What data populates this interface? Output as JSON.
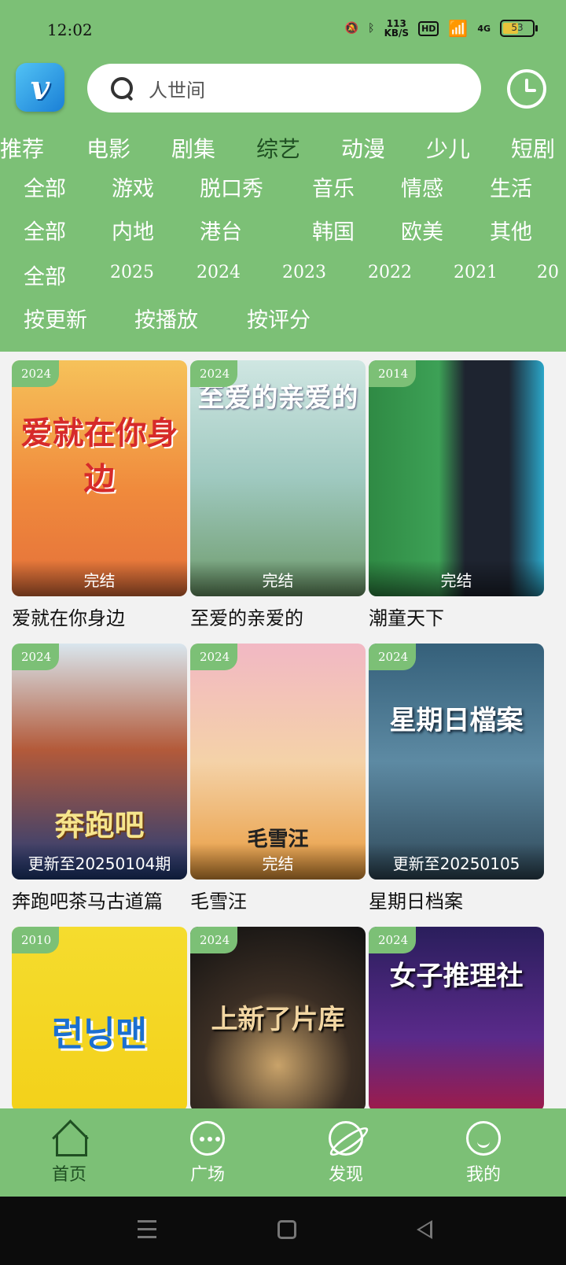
{
  "status_bar": {
    "time": "12:02",
    "net_speed_top": "113",
    "net_speed_unit": "KB/S",
    "hd": "HD",
    "network": "4G",
    "battery": "53",
    "battery_level": 0.53
  },
  "search": {
    "placeholder": "人世间"
  },
  "logo": {
    "letter": "v"
  },
  "categories": {
    "main": [
      "推荐",
      "电影",
      "剧集",
      "综艺",
      "动漫",
      "少儿",
      "短剧"
    ],
    "active_main": "综艺",
    "genre": [
      "全部",
      "游戏",
      "脱口秀",
      "音乐",
      "情感",
      "生活"
    ],
    "region": [
      "全部",
      "内地",
      "港台",
      "韩国",
      "欧美",
      "其他"
    ],
    "year": [
      "全部",
      "2025",
      "2024",
      "2023",
      "2022",
      "2021",
      "20"
    ],
    "sort": [
      "按更新",
      "按播放",
      "按评分"
    ]
  },
  "shows": [
    {
      "year": "2024",
      "status": "完结",
      "title": "爱就在你身边",
      "art": "爱就在你身边"
    },
    {
      "year": "2024",
      "status": "完结",
      "title": "至爱的亲爱的",
      "art": "至爱的亲爱的"
    },
    {
      "year": "2014",
      "status": "完结",
      "title": "潮童天下",
      "art": ""
    },
    {
      "year": "2024",
      "status": "更新至20250104期",
      "title": "奔跑吧茶马古道篇",
      "art": "奔跑吧"
    },
    {
      "year": "2024",
      "status": "完结",
      "title": "毛雪汪",
      "art": "毛雪汪"
    },
    {
      "year": "2024",
      "status": "更新至20250105",
      "title": "星期日档案",
      "art": "星期日檔案"
    },
    {
      "year": "2010",
      "status": "",
      "title": "",
      "art": "런닝맨"
    },
    {
      "year": "2024",
      "status": "",
      "title": "",
      "art": "上新了片库"
    },
    {
      "year": "2024",
      "status": "",
      "title": "",
      "art": "女子推理社"
    }
  ],
  "bottom_nav": [
    {
      "label": "首页",
      "icon": "home-icon"
    },
    {
      "label": "广场",
      "icon": "chat-icon"
    },
    {
      "label": "发现",
      "icon": "planet-icon"
    },
    {
      "label": "我的",
      "icon": "smile-icon"
    }
  ],
  "colors": {
    "primary_green": "#7cc076",
    "active_dark_green": "#1f4f22"
  }
}
